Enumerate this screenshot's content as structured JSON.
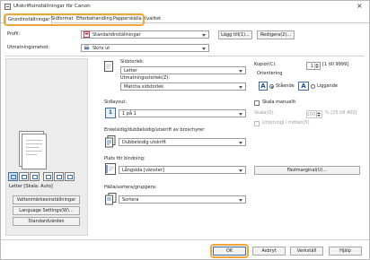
{
  "window": {
    "title": "Utskriftsinställningar för Canon",
    "close_glyph": "×"
  },
  "tabs": [
    {
      "label": "Grundinställningar",
      "active": true
    },
    {
      "label": "Sidformat",
      "active": false
    },
    {
      "label": "Efterbehandling",
      "active": false
    },
    {
      "label": "Papperskälla",
      "active": false
    },
    {
      "label": "Kvalitet",
      "active": false
    }
  ],
  "highlight_color": "#f0a43a",
  "profile": {
    "label": "Profil:",
    "value": "Standardinställningar",
    "add_button": "Lägg till(1)...",
    "edit_button": "Redigera(2)..."
  },
  "output_method": {
    "label": "Utmatningsmetod:",
    "value": "Skriv ut"
  },
  "preview": {
    "paper_label": "Letter [Skala: Auto]"
  },
  "left_buttons": {
    "watermark": "Vattenmärkesinställningar",
    "language": "Language Settings(W)...",
    "defaults": "Standardvärden"
  },
  "page_size": {
    "label": "Sidstorlek:",
    "value": "Letter",
    "output_label": "Utmatningsstorlek(Z):",
    "output_value": "Matcha sidstorlek"
  },
  "copies": {
    "label": "Kopior(C):",
    "value": "1",
    "range": "[1 till 9999]"
  },
  "orientation": {
    "label": "Orientering",
    "portrait": "Stående",
    "landscape": "Liggande",
    "portrait_icon": "A",
    "landscape_icon": "A"
  },
  "layout": {
    "label": "Sidlayout:",
    "value": "1 på 1",
    "icon": "1"
  },
  "manual_scaling": {
    "label": "Skala manuellt",
    "scale_label": "Skala(Q):",
    "scale_value": "100",
    "scale_range": "% [25 till 400]",
    "watermark_label": "Ursprungl i mitten(5)"
  },
  "duplex": {
    "label": "Enkelsidig/dubbelsidig/utskrift av broschyrer:",
    "value": "Dubbelsidig utskrift"
  },
  "binding": {
    "label": "Plats för bindning:",
    "value": "Långsida [vänster]",
    "gutter_button": "Fästmarginal(U)..."
  },
  "finishing": {
    "label": "Hälla/sortera/grupperа:",
    "value": "Sortera"
  },
  "bottom": {
    "ok": "OK",
    "cancel": "Avbryt",
    "apply": "Verkställ",
    "help": "Hjälp"
  }
}
